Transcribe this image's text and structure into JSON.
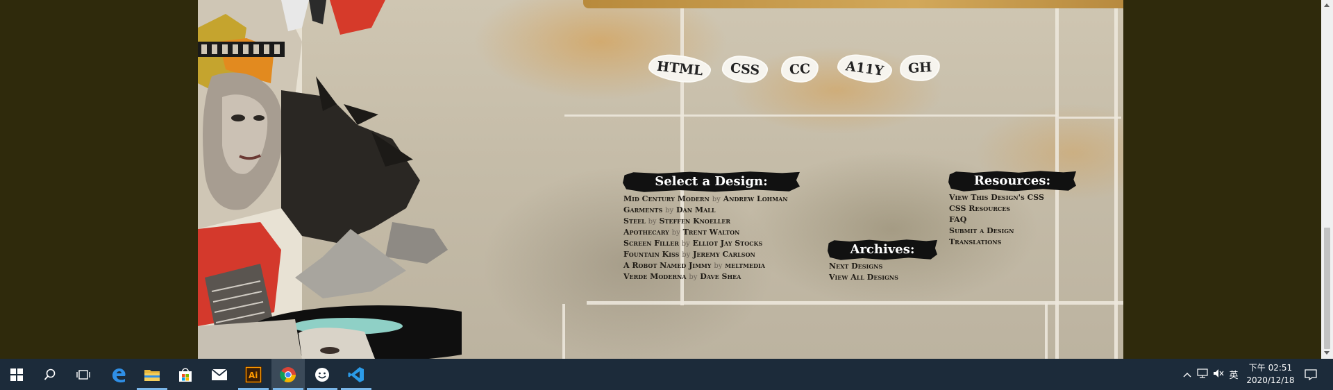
{
  "lang_tags": [
    "HTML",
    "CSS",
    "CC",
    "A11Y",
    "GH"
  ],
  "select_design": {
    "heading": "Select a Design:",
    "by": "by",
    "items": [
      {
        "title": "Mid Century Modern",
        "author": "Andrew Lohman"
      },
      {
        "title": "Garments",
        "author": "Dan Mall"
      },
      {
        "title": "Steel",
        "author": "Steffen Knoeller"
      },
      {
        "title": "Apothecary",
        "author": "Trent Walton"
      },
      {
        "title": "Screen Filler",
        "author": "Elliot Jay Stocks"
      },
      {
        "title": "Fountain Kiss",
        "author": "Jeremy Carlson"
      },
      {
        "title": "A Robot Named Jimmy",
        "author": "meltmedia"
      },
      {
        "title": "Verde Moderna",
        "author": "Dave Shea"
      }
    ]
  },
  "archives": {
    "heading": "Archives:",
    "items": [
      "Next Designs",
      "View All Designs"
    ]
  },
  "resources": {
    "heading": "Resources:",
    "items": [
      "View This Design's CSS",
      "CSS Resources",
      "FAQ",
      "Submit a Design",
      "Translations"
    ]
  },
  "taskbar": {
    "apps": [
      "start-icon",
      "search-icon",
      "task-view-icon",
      "edge-icon",
      "file-explorer-icon",
      "store-icon",
      "mail-icon",
      "illustrator-icon",
      "chrome-icon",
      "emoji-app-icon",
      "vscode-icon"
    ],
    "ime": "英",
    "time": "下午 02:51",
    "date": "2020/12/18"
  },
  "colors": {
    "backdrop": "#2f2a0c",
    "taskbar": "#1c2b3a",
    "accent": "#7ab6e8"
  }
}
